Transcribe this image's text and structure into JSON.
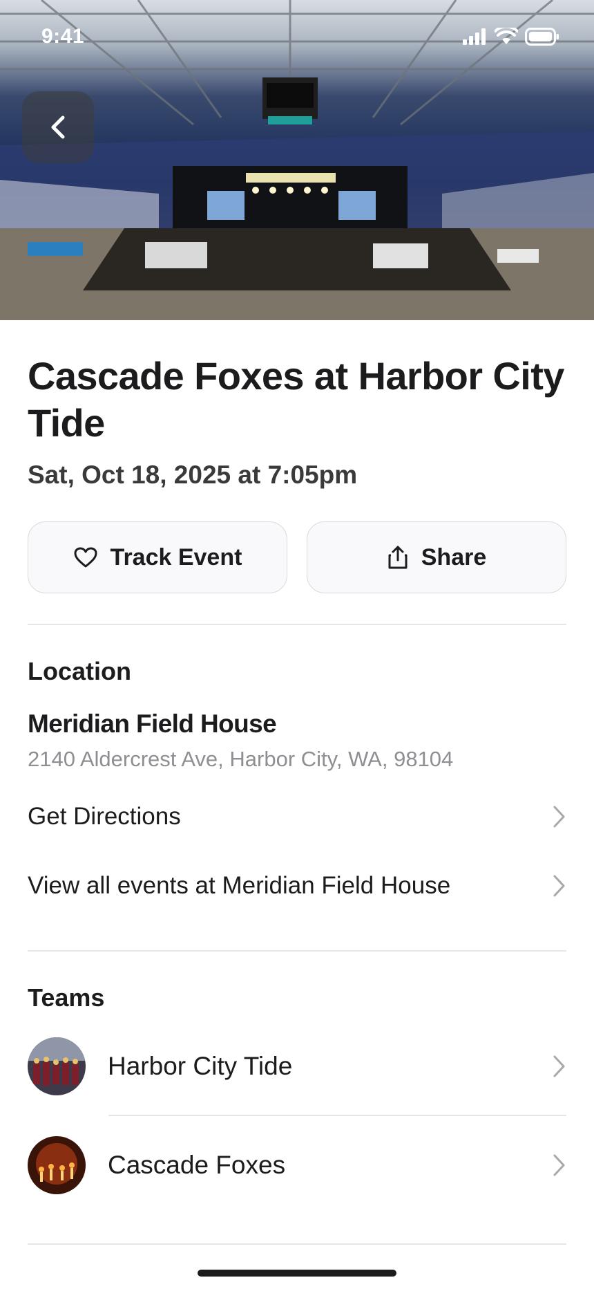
{
  "status_bar": {
    "time": "9:41"
  },
  "event": {
    "title": "Cascade Foxes at Harbor City Tide",
    "datetime": "Sat, Oct 18, 2025 at 7:05pm"
  },
  "actions": {
    "track_label": "Track Event",
    "share_label": "Share"
  },
  "location": {
    "section_title": "Location",
    "venue_name": "Meridian Field House",
    "address": "2140 Aldercrest Ave, Harbor City, WA, 98104",
    "directions_label": "Get Directions",
    "view_events_label": "View all events at Meridian Field House"
  },
  "teams": {
    "section_title": "Teams",
    "items": [
      {
        "name": "Harbor City Tide",
        "avatar_color": "#5a3b4a"
      },
      {
        "name": "Cascade Foxes",
        "avatar_color": "#8a2e12"
      }
    ]
  },
  "icons": {
    "back": "chevron-left-icon",
    "track": "heart-icon",
    "share": "share-icon",
    "row_chevron": "chevron-right-icon"
  }
}
